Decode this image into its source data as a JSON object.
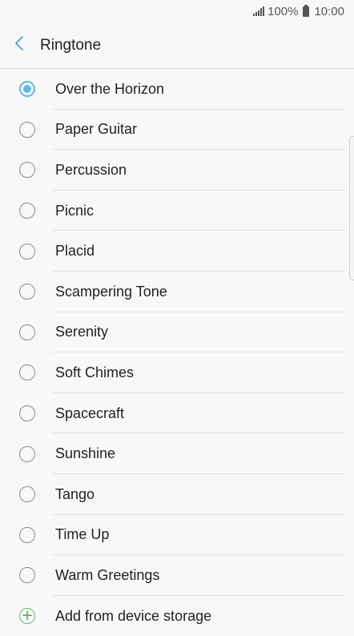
{
  "status_bar": {
    "battery_percent": "100%",
    "time": "10:00"
  },
  "header": {
    "title": "Ringtone"
  },
  "ringtones": [
    {
      "label": "Over the Horizon",
      "selected": true
    },
    {
      "label": "Paper Guitar",
      "selected": false
    },
    {
      "label": "Percussion",
      "selected": false
    },
    {
      "label": "Picnic",
      "selected": false
    },
    {
      "label": "Placid",
      "selected": false
    },
    {
      "label": "Scampering Tone",
      "selected": false
    },
    {
      "label": "Serenity",
      "selected": false
    },
    {
      "label": "Soft Chimes",
      "selected": false
    },
    {
      "label": "Spacecraft",
      "selected": false
    },
    {
      "label": "Sunshine",
      "selected": false
    },
    {
      "label": "Tango",
      "selected": false
    },
    {
      "label": "Time Up",
      "selected": false
    },
    {
      "label": "Warm Greetings",
      "selected": false
    }
  ],
  "add_item": {
    "label": "Add from device storage"
  },
  "colors": {
    "accent": "#5bbde0",
    "add_green": "#46a858"
  }
}
